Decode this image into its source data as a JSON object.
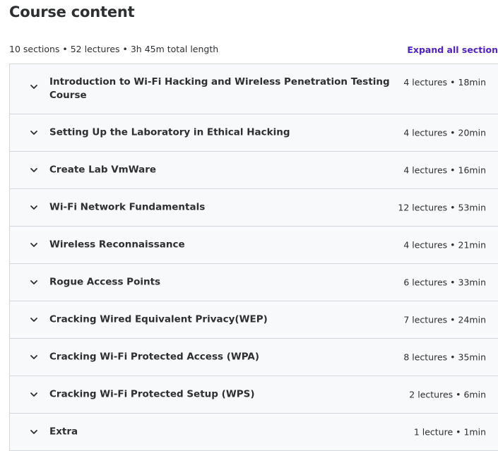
{
  "header": {
    "title": "Course content",
    "summary": "10 sections • 52 lectures • 3h 45m total length",
    "expand_all_label": "Expand all section"
  },
  "sections": [
    {
      "title": "Introduction to Wi-Fi Hacking and Wireless Penetration Testing Course",
      "info": "4 lectures • 18min"
    },
    {
      "title": "Setting Up the Laboratory in Ethical Hacking",
      "info": "4 lectures • 20min"
    },
    {
      "title": "Create Lab VmWare",
      "info": "4 lectures • 16min"
    },
    {
      "title": "Wi-Fi Network Fundamentals",
      "info": "12 lectures • 53min"
    },
    {
      "title": "Wireless Reconnaissance",
      "info": "4 lectures • 21min"
    },
    {
      "title": "Rogue Access Points",
      "info": "6 lectures • 33min"
    },
    {
      "title": "Cracking Wired Equivalent Privacy(WEP)",
      "info": "7 lectures • 24min"
    },
    {
      "title": "Cracking Wi-Fi Protected Access (WPA)",
      "info": "8 lectures • 35min"
    },
    {
      "title": "Cracking Wi-Fi Protected Setup (WPS)",
      "info": "2 lectures • 6min"
    },
    {
      "title": "Extra",
      "info": "1 lecture • 1min"
    }
  ],
  "icons": {
    "section_toggle": "chevron-down-icon"
  },
  "colors": {
    "accent": "#5022c3",
    "text": "#2d2f31",
    "section_bg": "#f7f9fa",
    "border": "#d1d7dc"
  }
}
